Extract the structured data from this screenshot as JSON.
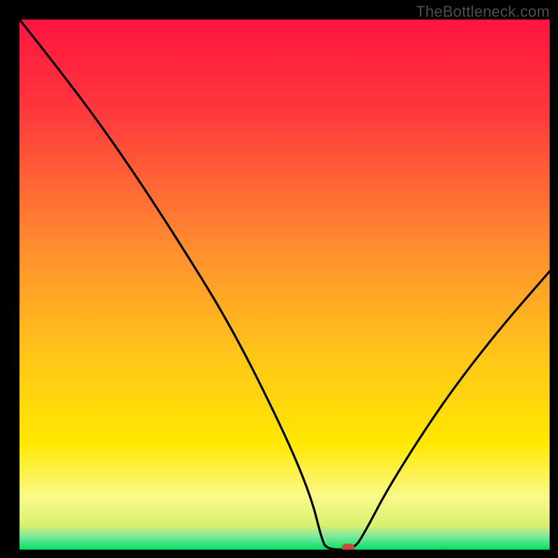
{
  "watermark": "TheBottleneck.com",
  "colors": {
    "top": "#ff1440",
    "middle": "#ffd800",
    "bottom_strip": "#00e060",
    "curve": "#000000",
    "marker_fill": "#c64b3f",
    "frame": "#000000"
  },
  "chart_data": {
    "type": "line",
    "title": "",
    "xlabel": "",
    "ylabel": "",
    "xlim": [
      0,
      100
    ],
    "ylim": [
      0,
      100
    ],
    "legend": false,
    "grid": false,
    "series": [
      {
        "name": "bottleneck-percentage-curve",
        "x": [
          0,
          10,
          20,
          30,
          40,
          50,
          55,
          57,
          58,
          63,
          65,
          70,
          80,
          90,
          100
        ],
        "values": [
          100,
          87.4,
          73.5,
          58.2,
          42.0,
          22.0,
          10.0,
          2.0,
          0.0,
          0.0,
          3.0,
          12.5,
          28.0,
          41.0,
          52.5
        ]
      }
    ],
    "annotations": [
      {
        "name": "marker",
        "x": 62,
        "y": 0
      }
    ],
    "background_gradient": {
      "direction": "vertical",
      "stops": [
        {
          "pos": 0.0,
          "color": "#ff1440"
        },
        {
          "pos": 0.18,
          "color": "#ff3a3c"
        },
        {
          "pos": 0.42,
          "color": "#ff8a30"
        },
        {
          "pos": 0.62,
          "color": "#ffc21a"
        },
        {
          "pos": 0.8,
          "color": "#ffe800"
        },
        {
          "pos": 0.9,
          "color": "#faf98a"
        },
        {
          "pos": 0.955,
          "color": "#d8f070"
        },
        {
          "pos": 0.975,
          "color": "#7de8a0"
        },
        {
          "pos": 1.0,
          "color": "#00e060"
        }
      ]
    }
  },
  "layout": {
    "plot_left": 28,
    "plot_top": 28,
    "plot_right": 788,
    "plot_bottom": 788
  }
}
